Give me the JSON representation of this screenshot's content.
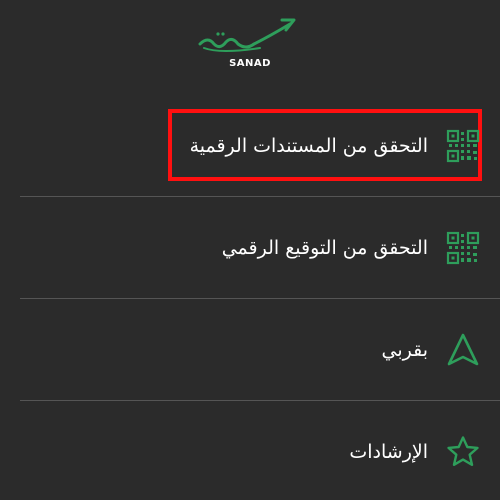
{
  "header": {
    "logo_text": "SANAD"
  },
  "menu": {
    "items": [
      {
        "label": "التحقق من المستندات الرقمية",
        "icon": "qr-code-icon"
      },
      {
        "label": "التحقق من التوقيع الرقمي",
        "icon": "qr-code-icon"
      },
      {
        "label": "بقربي",
        "icon": "navigation-arrow-icon"
      },
      {
        "label": "الإرشادات",
        "icon": "star-icon"
      }
    ]
  },
  "colors": {
    "background": "#2b2b2b",
    "accent_green": "#2e9e5b",
    "highlight_red": "#ff1010",
    "divider": "#555555"
  }
}
